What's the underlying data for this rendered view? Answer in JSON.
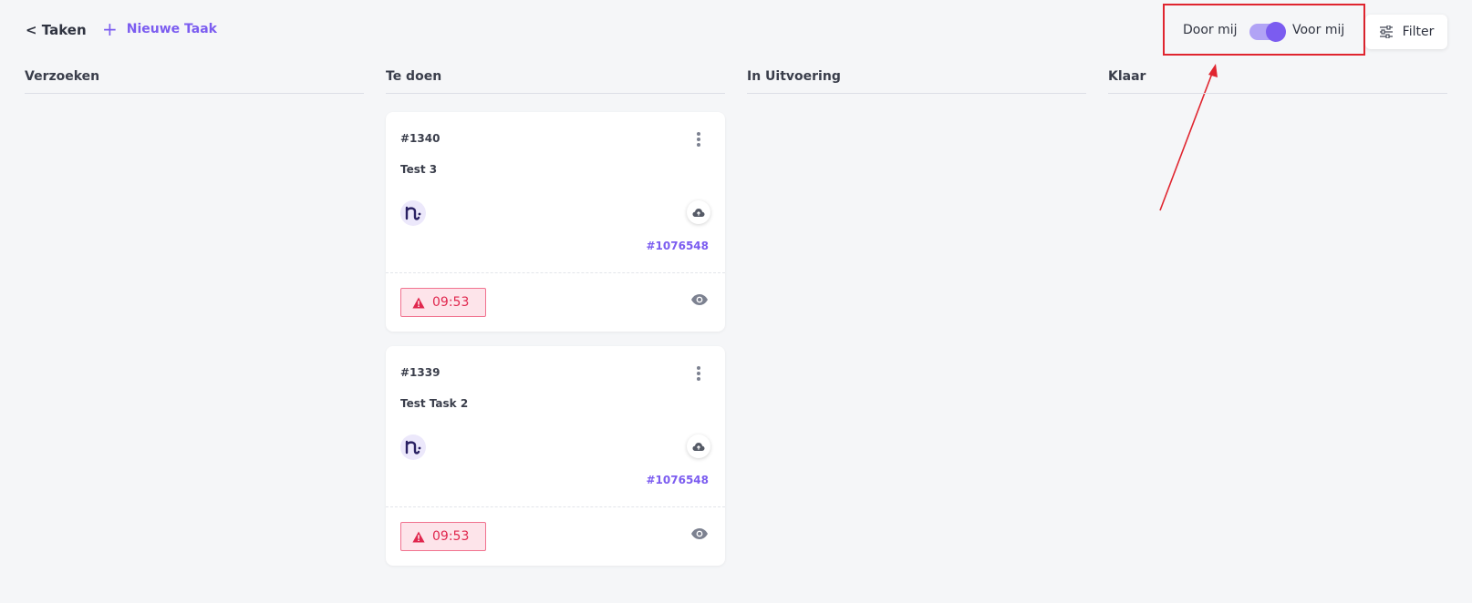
{
  "header": {
    "back_label": "< Taken",
    "new_task_label": "Nieuwe Taak",
    "toggle": {
      "left_label": "Door mij",
      "right_label": "Voor mij",
      "state": "on"
    },
    "filter_label": "Filter"
  },
  "columns": [
    {
      "title": "Verzoeken"
    },
    {
      "title": "Te doen"
    },
    {
      "title": "In Uitvoering"
    },
    {
      "title": "Klaar"
    }
  ],
  "cards": [
    {
      "id": "#1340",
      "title": "Test 3",
      "reference": "#1076548",
      "deadline": "09:53"
    },
    {
      "id": "#1339",
      "title": "Test Task 2",
      "reference": "#1076548",
      "deadline": "09:53"
    }
  ],
  "icons": {
    "menu": "vertical-dots-icon",
    "cloud": "cloud-upload-icon",
    "warning": "warning-triangle-icon",
    "eye": "eye-icon",
    "filter": "sliders-icon",
    "avatar": "brand-logo-icon"
  },
  "colors": {
    "accent": "#7b5cf0",
    "deadline_text": "#e0274e",
    "deadline_bg": "#fde4ea",
    "annotation": "#e0252f"
  }
}
